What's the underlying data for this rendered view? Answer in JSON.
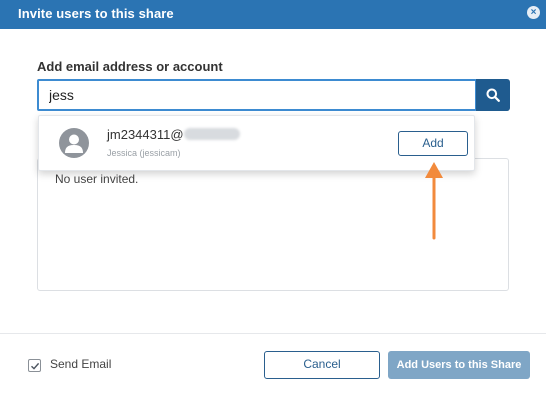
{
  "dialog": {
    "title": "Invite users to this share",
    "close_icon": "close-icon",
    "accent": "#2b74b3"
  },
  "search": {
    "label": "Add email address or account",
    "value": "jess",
    "icon": "search-icon"
  },
  "suggestion": {
    "name_visible": "jm2344311@",
    "subtitle": "Jessica (jessicam)",
    "add_label": "Add",
    "avatar_icon": "user-avatar-icon"
  },
  "invited": {
    "empty_text": "No user invited."
  },
  "footer": {
    "send_email_label": "Send Email",
    "send_email_checked": true,
    "cancel_label": "Cancel",
    "submit_label": "Add Users to this Share"
  },
  "annotation": {
    "arrow_color": "#f28a3c"
  }
}
